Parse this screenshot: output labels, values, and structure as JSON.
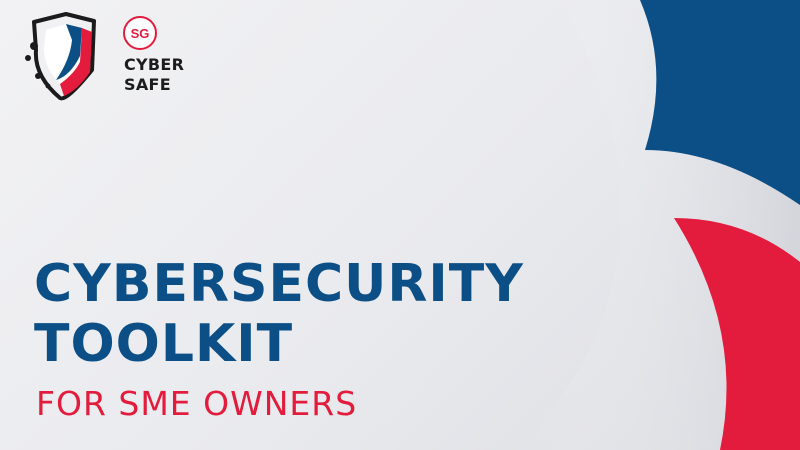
{
  "logo": {
    "badge": "SG",
    "line1": "CYBER",
    "line2": "SAFE"
  },
  "title": {
    "line1": "CYBERSECURITY",
    "line2": "TOOLKIT",
    "subtitle": "FOR SME OWNERS"
  },
  "colors": {
    "navy": "#0c4f86",
    "red": "#e31c3d",
    "background": "#ececef"
  }
}
